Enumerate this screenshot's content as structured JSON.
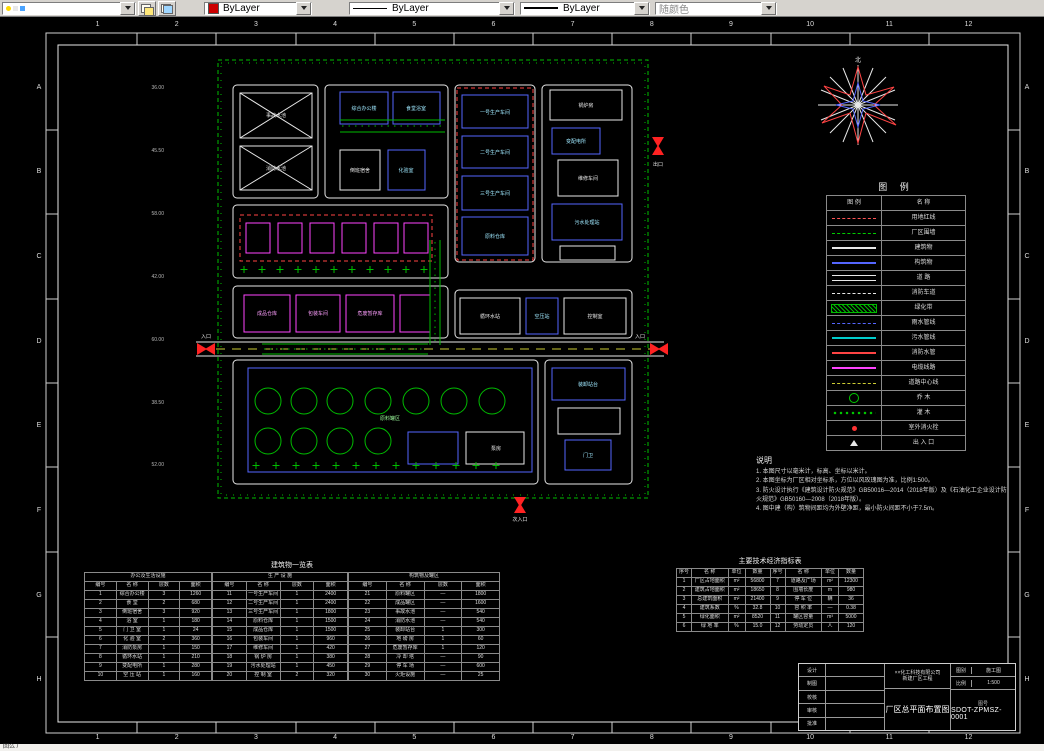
{
  "toolbar": {
    "color": {
      "value": "ByLayer",
      "swatch": "#cc0000"
    },
    "linetype": {
      "value": "ByLayer"
    },
    "lineweight": {
      "value": "ByLayer"
    },
    "plotstyle": {
      "value": "随颜色"
    }
  },
  "statusbar": {
    "text": "回么 /"
  },
  "frame": {
    "cols": [
      "1",
      "2",
      "3",
      "4",
      "5",
      "6",
      "7",
      "8",
      "9",
      "10",
      "11",
      "12"
    ],
    "rows": [
      "A",
      "B",
      "C",
      "D",
      "E",
      "F",
      "G",
      "H"
    ]
  },
  "plan": {
    "north_label": "北",
    "gate_labels": [
      "入口",
      "入口",
      "出口",
      "次入口"
    ],
    "dims_left": [
      "36.00",
      "45.50",
      "58.00",
      "42.00",
      "60.00",
      "38.50",
      "52.00"
    ],
    "labels": [
      "事故水池",
      "消防水池",
      "综合办公楼",
      "食堂浴室",
      "倒班宿舍",
      "化验室",
      "一号生产车间",
      "二号生产车间",
      "三号生产车间",
      "原料仓库",
      "锅炉房",
      "变配电所",
      "维修车间",
      "污水处理站",
      "成品仓库",
      "包装车间",
      "危废暂存库",
      "原料罐区",
      "泵房",
      "装卸站台",
      "门卫",
      "循环水站",
      "空压站",
      "控制室"
    ]
  },
  "legend": {
    "title": "图 例",
    "col_symbol": "图 例",
    "col_name": "名 称",
    "rows": [
      {
        "sym": "s-red-dash",
        "name": "用地红线"
      },
      {
        "sym": "s-green-dash",
        "name": "厂区围墙"
      },
      {
        "sym": "s-white-solid",
        "name": "建筑物"
      },
      {
        "sym": "s-blue-solid",
        "name": "构筑物"
      },
      {
        "sym": "s-double",
        "name": "道 路"
      },
      {
        "sym": "s-white-dash",
        "name": "消防车道"
      },
      {
        "sym": "s-hatch",
        "name": "绿化带"
      },
      {
        "sym": "s-blue-dash",
        "name": "雨水管线"
      },
      {
        "sym": "s-cyan-solid",
        "name": "污水管线"
      },
      {
        "sym": "s-red-solid",
        "name": "消防水管"
      },
      {
        "sym": "s-magenta",
        "name": "电缆线路"
      },
      {
        "sym": "s-yellow-dash",
        "name": "道路中心线"
      },
      {
        "sym": "s-tree",
        "name": "乔 木"
      },
      {
        "sym": "s-shrub",
        "name": "灌 木"
      },
      {
        "sym": "s-hydrant",
        "name": "室外消火栓"
      },
      {
        "sym": "s-gate",
        "name": "出 入 口"
      }
    ]
  },
  "notes": {
    "title": "说明",
    "lines": [
      "1. 本图尺寸以毫米计，标高、坐标以米计。",
      "2. 本图坐标为厂区相对坐标系，方位以风玫瑰图为准，比例1:500。",
      "3. 防火设计执行《建筑设计防火规范》GB50016—2014（2018年版）及《石油化工企业设计防火规范》GB50160—2008（2018年版）。",
      "4. 图中建（构）筑物间距均为外壁净距，最小防火间距不小于7.5m。"
    ]
  },
  "building_table": {
    "title": "建筑物一览表",
    "headers": [
      "编号",
      "名  称",
      "层数",
      "面积"
    ],
    "a": {
      "caption": "办公及生活设施",
      "rows": [
        [
          "1",
          "综合办公楼",
          "3",
          "1260"
        ],
        [
          "2",
          "食  堂",
          "2",
          "680"
        ],
        [
          "3",
          "倒班宿舍",
          "3",
          "920"
        ],
        [
          "4",
          "浴  室",
          "1",
          "180"
        ],
        [
          "5",
          "门 卫 室",
          "1",
          "24"
        ],
        [
          "6",
          "化 验 室",
          "2",
          "360"
        ],
        [
          "7",
          "消防泵房",
          "1",
          "150"
        ],
        [
          "8",
          "循环水站",
          "1",
          "210"
        ],
        [
          "9",
          "变配电所",
          "1",
          "280"
        ],
        [
          "10",
          "空 压 站",
          "1",
          "160"
        ]
      ]
    },
    "b": {
      "caption": "生 产 设 施",
      "rows": [
        [
          "11",
          "一号生产车间",
          "1",
          "2400"
        ],
        [
          "12",
          "二号生产车间",
          "1",
          "2400"
        ],
        [
          "13",
          "三号生产车间",
          "1",
          "1800"
        ],
        [
          "14",
          "原料仓库",
          "1",
          "1500"
        ],
        [
          "15",
          "成品仓库",
          "1",
          "1500"
        ],
        [
          "16",
          "包装车间",
          "1",
          "960"
        ],
        [
          "17",
          "维修车间",
          "1",
          "420"
        ],
        [
          "18",
          "锅 炉 房",
          "1",
          "380"
        ],
        [
          "19",
          "污水处理站",
          "1",
          "450"
        ],
        [
          "20",
          "控 制 室",
          "2",
          "320"
        ]
      ]
    },
    "c": {
      "caption": "构筑物及罐区",
      "rows": [
        [
          "21",
          "原料罐区",
          "—",
          "1800"
        ],
        [
          "22",
          "成品罐区",
          "—",
          "1600"
        ],
        [
          "23",
          "事故水池",
          "—",
          "540"
        ],
        [
          "24",
          "消防水池",
          "—",
          "540"
        ],
        [
          "25",
          "装卸站台",
          "1",
          "300"
        ],
        [
          "26",
          "地 磅 房",
          "1",
          "60"
        ],
        [
          "27",
          "危废暂存库",
          "1",
          "120"
        ],
        [
          "28",
          "冷 却 塔",
          "—",
          "90"
        ],
        [
          "29",
          "停 车 场",
          "—",
          "600"
        ],
        [
          "30",
          "火炬设施",
          "—",
          "25"
        ]
      ]
    }
  },
  "metrics_table": {
    "title": "主要技术经济指标表",
    "headers": [
      "序号",
      "名  称",
      "单位",
      "数量",
      "序号",
      "名  称",
      "单位",
      "数量"
    ],
    "rows": [
      [
        "1",
        "厂区占地面积",
        "m²",
        "56800",
        "7",
        "道路及广场",
        "m²",
        "12300"
      ],
      [
        "2",
        "建筑占地面积",
        "m²",
        "18650",
        "8",
        "围墙长度",
        "m",
        "980"
      ],
      [
        "3",
        "总建筑面积",
        "m²",
        "21400",
        "9",
        "停 车 位",
        "辆",
        "36"
      ],
      [
        "4",
        "建筑系数",
        "%",
        "32.8",
        "10",
        "容 积 率",
        "—",
        "0.38"
      ],
      [
        "5",
        "绿化面积",
        "m²",
        "8520",
        "11",
        "罐区容量",
        "m³",
        "5000"
      ],
      [
        "6",
        "绿 地 率",
        "%",
        "15.0",
        "12",
        "劳动定员",
        "人",
        "120"
      ]
    ]
  },
  "title_block": {
    "company": "××化工科技有限公司",
    "project": "新建厂区工程",
    "drawing_title": "厂区总平面布置图",
    "sign_rows": [
      [
        "设计",
        ""
      ],
      [
        "制图",
        ""
      ],
      [
        "校核",
        ""
      ],
      [
        "审核",
        ""
      ],
      [
        "批准",
        ""
      ]
    ],
    "stage_label": "图别",
    "stage": "施工图",
    "scale_label": "比例",
    "scale": "1:500",
    "no_label": "图号",
    "number": "SDOT-ZPMSZ-0001"
  }
}
